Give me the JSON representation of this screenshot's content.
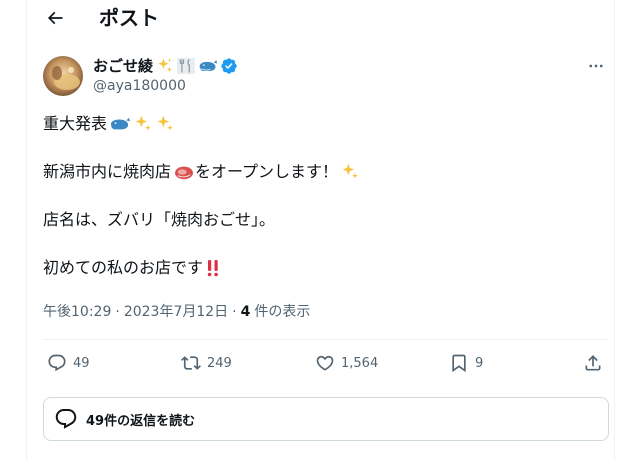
{
  "header": {
    "title": "ポスト"
  },
  "author": {
    "display_name": "おごせ綾",
    "handle": "@aya180000",
    "name_emojis": [
      "sparkles-icon",
      "fork-knife-icon",
      "whale-icon"
    ],
    "verified": true
  },
  "tweet": {
    "line1_text": "重大発表",
    "line2_text_a": "新潟市内に焼肉店",
    "line2_text_b": "をオープンします！",
    "line3_text": "店名は、ズバリ「焼肉おごせ」。",
    "line4_text": "初めての私のお店です"
  },
  "meta": {
    "time": "午後10:29",
    "separator": "·",
    "date": "2023年7月12日",
    "views_count": "4",
    "views_label": "件の表示"
  },
  "actions": {
    "reply_count": "49",
    "retweet_count": "249",
    "like_count": "1,564",
    "bookmark_count": "9"
  },
  "replies_button": {
    "label": "49件の返信を読む"
  },
  "colors": {
    "text": "#0f1419",
    "secondary": "#536471",
    "verified": "#1d9bf0",
    "border": "#cfd9de",
    "divider": "#eff3f4"
  }
}
